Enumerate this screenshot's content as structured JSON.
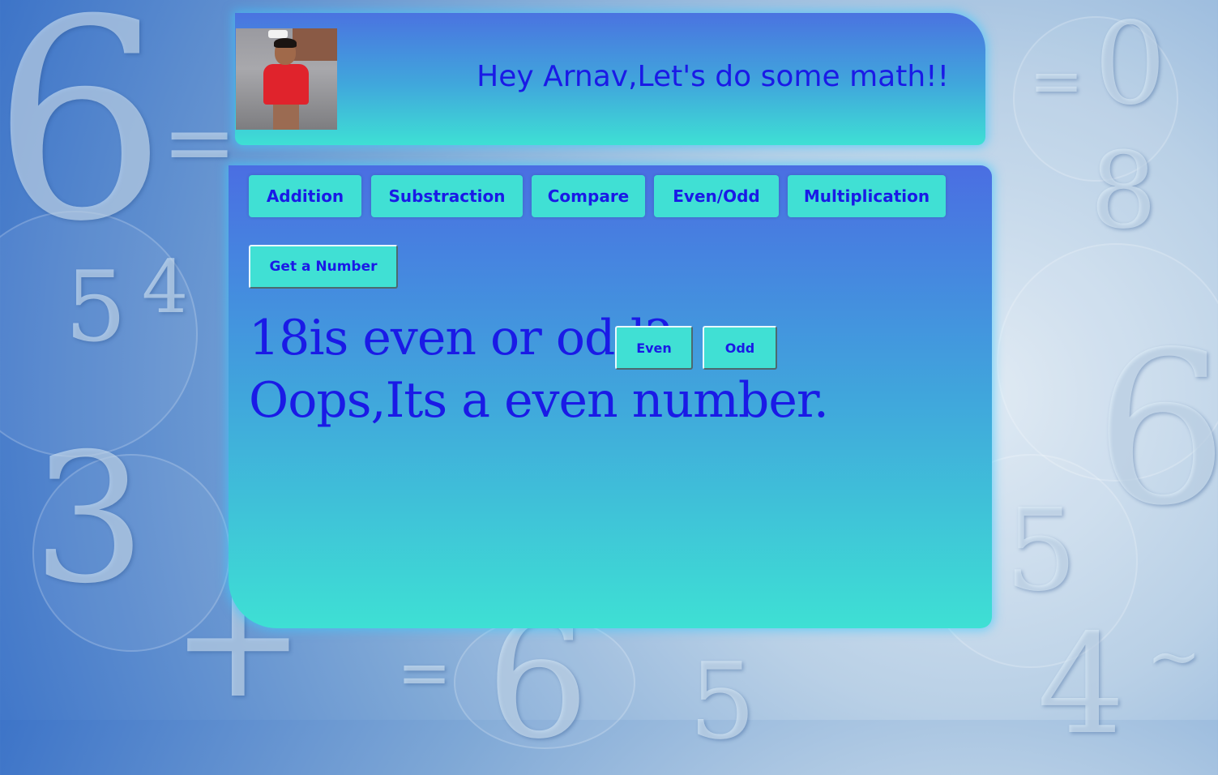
{
  "header": {
    "greeting": "Hey Arnav,Let's do some math!!"
  },
  "tabs": [
    {
      "label": "Addition"
    },
    {
      "label": "Substraction"
    },
    {
      "label": "Compare"
    },
    {
      "label": "Even/Odd"
    },
    {
      "label": "Multiplication"
    }
  ],
  "controls": {
    "get_number_label": "Get a Number",
    "even_label": "Even",
    "odd_label": "Odd"
  },
  "game": {
    "number": "18",
    "question_text": "is even or odd?",
    "result_text": "Oops,Its a even number."
  },
  "colors": {
    "text_accent": "#1a1ae6",
    "button_bg": "#40e0d4",
    "panel_top": "#4a6ee2",
    "panel_bottom": "#3ee0d4"
  }
}
